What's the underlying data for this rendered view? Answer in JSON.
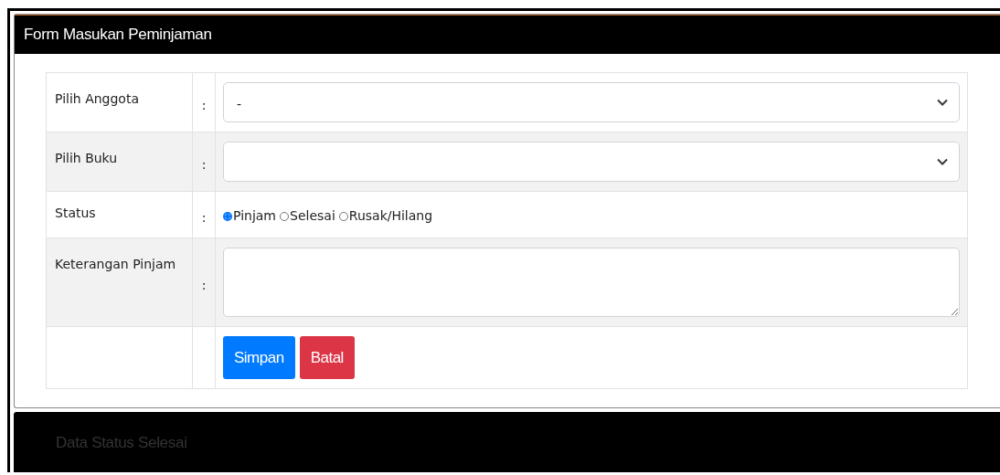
{
  "form_panel": {
    "title": "Form Masukan Peminjaman",
    "rows": [
      {
        "kind": "select",
        "label": "Pilih Anggota",
        "separator": ":",
        "value": "-"
      },
      {
        "kind": "select",
        "label": "Pilih Buku",
        "separator": ":"
      },
      {
        "kind": "radio",
        "label": "Status",
        "separator": ":",
        "options": [
          {
            "label": "Pinjam",
            "selected": true
          },
          {
            "label": "Selesai",
            "selected": false
          },
          {
            "label": "Rusak/Hilang",
            "selected": false
          }
        ]
      },
      {
        "kind": "textarea",
        "label": "Keterangan Pinjam",
        "separator": ":"
      },
      {
        "kind": "buttons",
        "buttons": [
          {
            "label": "Simpan",
            "kind": "primary"
          },
          {
            "label": "Batal",
            "kind": "danger"
          }
        ]
      }
    ]
  },
  "status_panel": {
    "title": "Data Status Selesai"
  }
}
